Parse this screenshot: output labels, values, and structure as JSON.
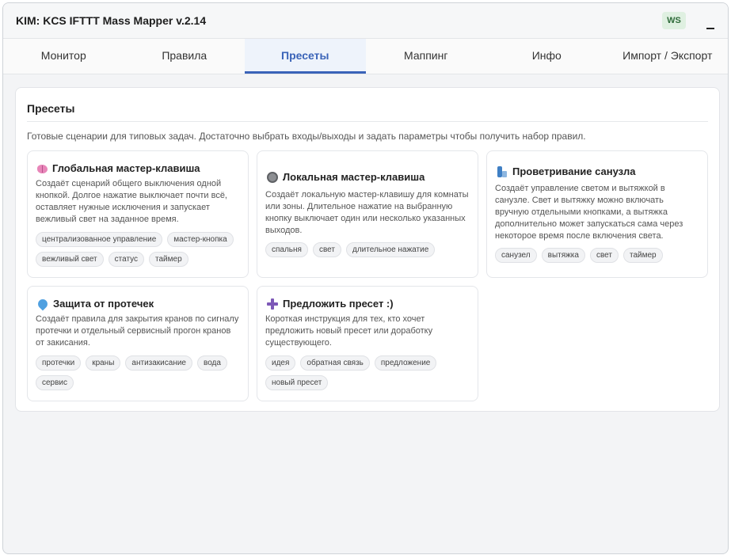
{
  "app": {
    "title": "KIM: KCS IFTTT Mass Mapper v.2.14",
    "ws_badge": "WS"
  },
  "tabs": [
    {
      "label": "Монитор"
    },
    {
      "label": "Правила"
    },
    {
      "label": "Пресеты"
    },
    {
      "label": "Маппинг"
    },
    {
      "label": "Инфо"
    },
    {
      "label": "Импорт / Экспорт"
    }
  ],
  "active_tab": "Пресеты",
  "presets": {
    "title": "Пресеты",
    "description": "Готовые сценарии для типовых задач. Достаточно выбрать входы/выходы и задать параметры чтобы получить набор правил.",
    "cards": [
      {
        "icon": "brain-icon",
        "title": "Глобальная мастер-клавиша",
        "description": "Создаёт сценарий общего выключения одной кнопкой. Долгое нажатие выключает почти всё, оставляет нужные исключения и запускает вежливый свет на заданное время.",
        "tags": [
          "централизованное управление",
          "мастер-кнопка",
          "вежливый свет",
          "статус",
          "таймер"
        ]
      },
      {
        "icon": "circle-icon",
        "title": "Локальная мастер-клавиша",
        "description": "Создаёт локальную мастер-клавишу для комнаты или зоны. Длительное нажатие на выбранную кнопку выключает один или несколько указанных выходов.",
        "tags": [
          "спальня",
          "свет",
          "длительное нажатие"
        ]
      },
      {
        "icon": "bathroom-icon",
        "title": "Проветривание санузла",
        "description": "Создаёт управление светом и вытяжкой в санузле. Свет и вытяжку можно включать вручную отдельными кнопками, а вытяжка дополнительно может запускаться сама через некоторое время после включения света.",
        "tags": [
          "санузел",
          "вытяжка",
          "свет",
          "таймер"
        ]
      },
      {
        "icon": "water-drop-icon",
        "title": "Защита от протечек",
        "description": "Создаёт правила для закрытия кранов по сигналу протечки и отдельный сервисный прогон кранов от закисания.",
        "tags": [
          "протечки",
          "краны",
          "антизакисание",
          "вода",
          "сервис"
        ]
      },
      {
        "icon": "plus-icon",
        "title": "Предложить пресет :)",
        "description": "Короткая инструкция для тех, кто хочет предложить новый пресет или доработку существующего.",
        "tags": [
          "идея",
          "обратная связь",
          "предложение",
          "новый пресет"
        ]
      }
    ]
  }
}
